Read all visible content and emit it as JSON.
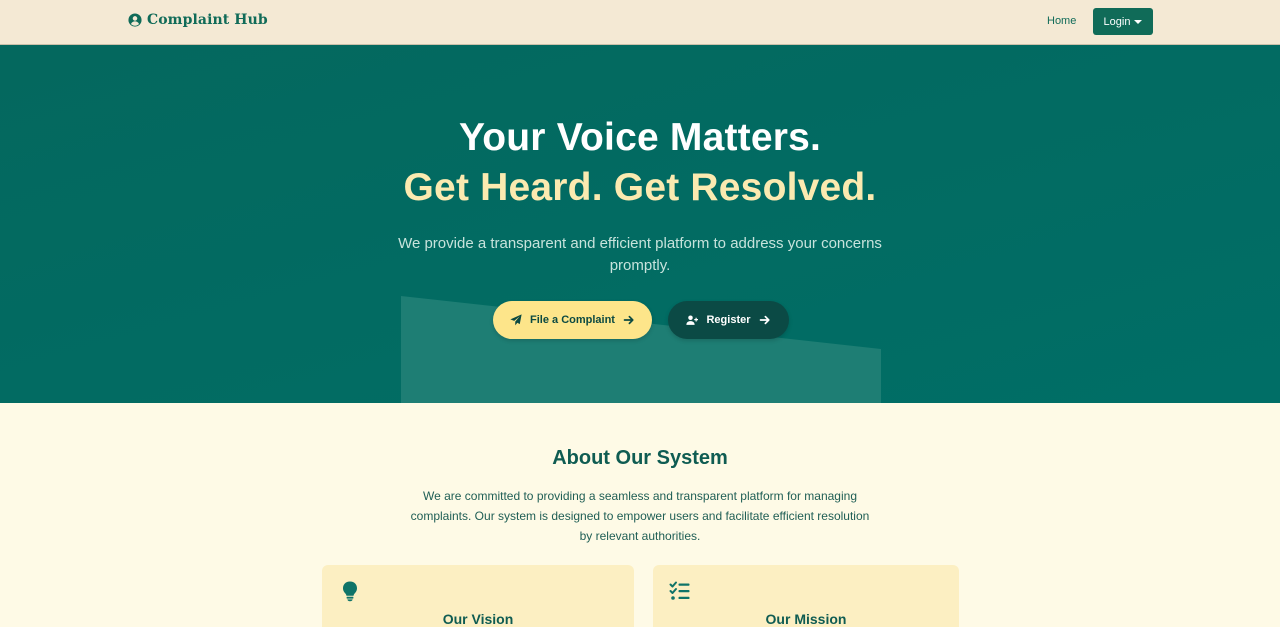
{
  "navbar": {
    "brand": "Complaint Hub",
    "brand_icon": "user-circle-icon",
    "home_label": "Home",
    "login_label": "Login"
  },
  "hero": {
    "title_line1": "Your Voice Matters.",
    "title_line2": "Get Heard. Get Resolved.",
    "subtitle": "We provide a transparent and efficient platform to address your concerns promptly.",
    "file_button_label": "File a Complaint",
    "register_button_label": "Register"
  },
  "about": {
    "title": "About Our System",
    "text": "We are committed to providing a seamless and transparent platform for managing complaints. Our system is designed to empower users and facilitate efficient resolution by relevant authorities.",
    "cards": [
      {
        "title": "Our Vision",
        "icon": "lightbulb-icon"
      },
      {
        "title": "Our Mission",
        "icon": "checklist-icon"
      }
    ]
  },
  "colors": {
    "primary": "#106b58",
    "hero_bg": "#026b63",
    "accent_yellow": "#fde58a",
    "dark_teal": "#0b4a45",
    "page_bg": "#fefae6",
    "nav_bg": "#f4e9d4"
  }
}
